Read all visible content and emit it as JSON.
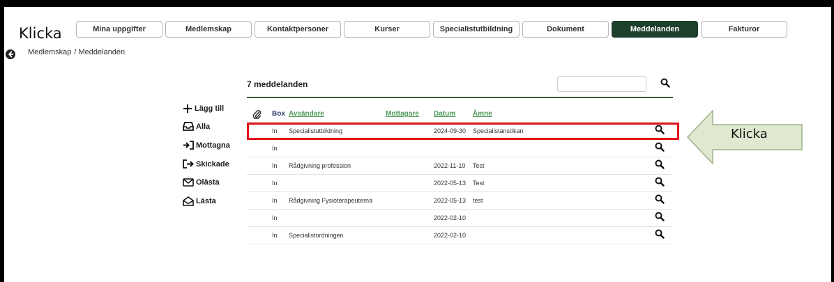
{
  "annotation": {
    "left_text": "Klicka",
    "arrow_text": "Klicka",
    "highlight_color": "#e3151b",
    "arrow_fill": "#dfe9cf"
  },
  "tabs": [
    {
      "label": "Mina uppgifter",
      "active": false
    },
    {
      "label": "Medlemskap",
      "active": false
    },
    {
      "label": "Kontaktpersoner",
      "active": false
    },
    {
      "label": "Kurser",
      "active": false
    },
    {
      "label": "Specialistutbildning",
      "active": false
    },
    {
      "label": "Dokument",
      "active": false
    },
    {
      "label": "Meddelanden",
      "active": true
    },
    {
      "label": "Fakturor",
      "active": false
    }
  ],
  "breadcrumb": {
    "parent": "Medlemskap",
    "current": "/ Meddelanden"
  },
  "actions": {
    "add": "Lägg till",
    "all": "Alla",
    "inbox": "Mottagna",
    "sent": "Skickade",
    "unread": "Olästa",
    "read": "Lästa"
  },
  "list": {
    "title": "7 meddelanden",
    "search_placeholder": "",
    "columns": {
      "box": "Box",
      "sender": "Avsändare",
      "recipient": "Mottagare",
      "date": "Datum",
      "subject": "Ämne"
    },
    "rows": [
      {
        "box": "In",
        "sender": "Specialistutbildning",
        "recipient": "",
        "date": "2024-09-30",
        "subject": "Specialistansökan"
      },
      {
        "box": "In",
        "sender": "",
        "recipient": "",
        "date": "",
        "subject": ""
      },
      {
        "box": "In",
        "sender": "Rådgivning profession",
        "recipient": "",
        "date": "2022-11-10",
        "subject": "Test"
      },
      {
        "box": "In",
        "sender": "",
        "recipient": "",
        "date": "2022-05-13",
        "subject": "Test"
      },
      {
        "box": "In",
        "sender": "Rådgivning Fysioterapeuterna",
        "recipient": "",
        "date": "2022-05-13",
        "subject": "test"
      },
      {
        "box": "In",
        "sender": "",
        "recipient": "",
        "date": "2022-02-10",
        "subject": ""
      },
      {
        "box": "In",
        "sender": "Specialistordningen",
        "recipient": "",
        "date": "2022-02-10",
        "subject": ""
      }
    ]
  },
  "colors": {
    "accent": "#1d3f2c",
    "link": "#4e9a59",
    "header_plain": "#2a3d6a"
  }
}
